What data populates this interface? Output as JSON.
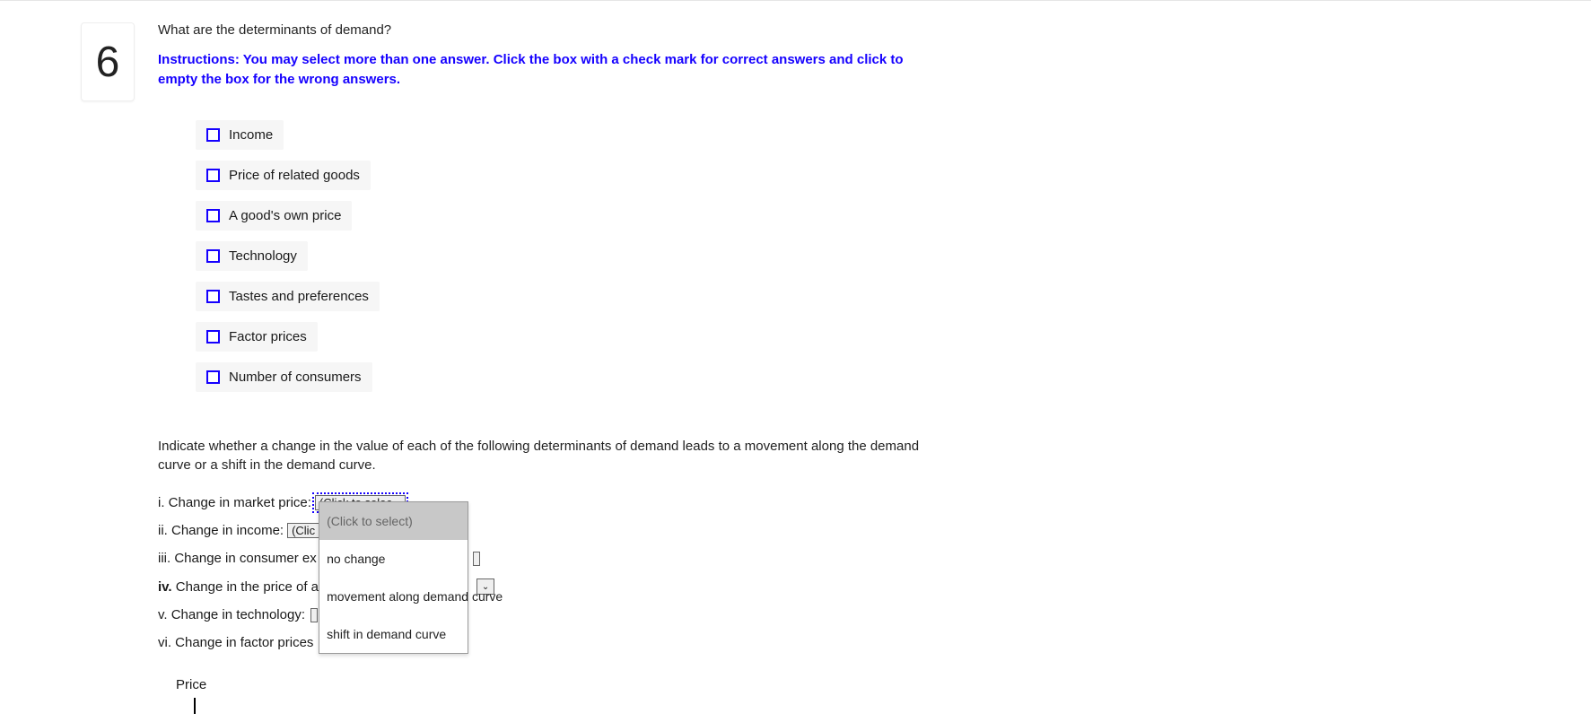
{
  "question_number": "6",
  "question_text": "What are the determinants of demand?",
  "instructions": "Instructions: You may select more than one answer. Click the box with a check mark for correct answers and click to empty the box for the wrong answers.",
  "checkboxes": [
    {
      "label": "Income"
    },
    {
      "label": "Price of related goods"
    },
    {
      "label": "A good's own price"
    },
    {
      "label": "Technology"
    },
    {
      "label": "Tastes and preferences"
    },
    {
      "label": "Factor prices"
    },
    {
      "label": "Number of consumers"
    }
  ],
  "subprompt": "Indicate whether a change in the value of each of the following determinants of demand leads to a movement along the demand curve or a shift in the demand curve.",
  "subitems": {
    "i_label": "i. Change in market price:",
    "ii_label": "ii. Change in income:",
    "iii_label": "iii. Change in consumer ex",
    "iv_label_prefix": "iv.",
    "iv_label_rest": " Change in the price of a",
    "v_label": "v. Change in technology:",
    "vi_label": "vi. Change in factor prices"
  },
  "select_collapsed": "(Click to selec",
  "select_collapsed_short": "(Clic",
  "dropdown": {
    "opt0": "(Click to select)",
    "opt1": "no change",
    "opt2": "movement along demand curve",
    "opt3": "shift in demand curve"
  },
  "chart": {
    "axis_label": "Price"
  }
}
